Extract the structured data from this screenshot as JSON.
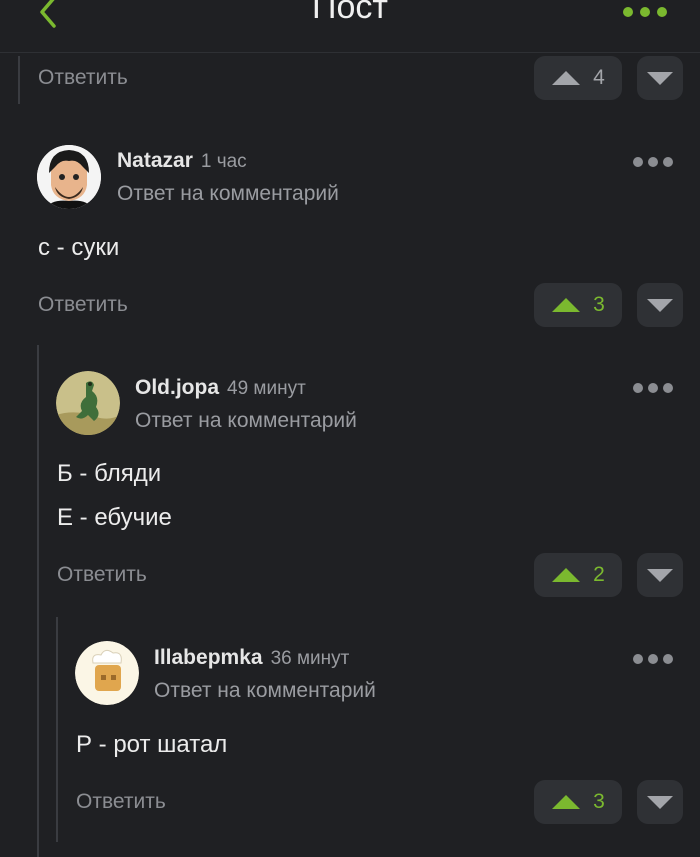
{
  "header": {
    "title": "Пост",
    "accent_color": "#7bb92f",
    "back_icon": "chevron-left-icon",
    "more_icon": "more-horizontal-icon"
  },
  "top_reply": {
    "reply_label": "Ответить",
    "votes": "4"
  },
  "comments": [
    {
      "author": "Natazar",
      "time": "1 час",
      "reply_to": "Ответ на комментарий",
      "lines": [
        "с - суки"
      ],
      "reply_label": "Ответить",
      "votes": "3"
    },
    {
      "author": "Old.jopa",
      "time": "49 минут",
      "reply_to": "Ответ на комментарий",
      "lines": [
        "Б - бляди",
        "Е - ебучие"
      ],
      "reply_label": "Ответить",
      "votes": "2"
    },
    {
      "author": "Illabepmka",
      "time": "36 минут",
      "reply_to": "Ответ на комментарий",
      "lines": [
        "Р - рот шатал"
      ],
      "reply_label": "Ответить",
      "votes": "3"
    }
  ]
}
